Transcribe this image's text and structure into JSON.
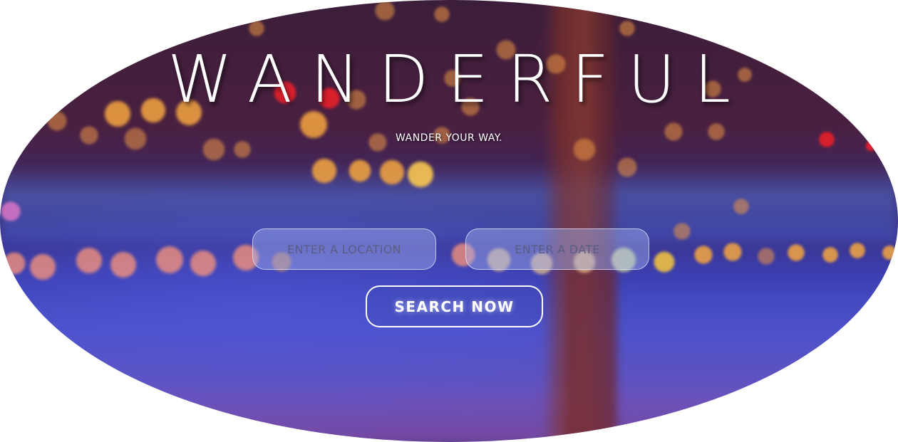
{
  "hero": {
    "title": "WANDERFUL",
    "subtitle": "WANDER YOUR WAY."
  },
  "search": {
    "location_placeholder": "ENTER A LOCATION",
    "date_placeholder": "ENTER A DATE",
    "button_label": "SEARCH NOW"
  },
  "background": {
    "image_subject": "blurred-bridge-bokeh-night",
    "colors": {
      "sky": "#3b1e3a",
      "water": "#4b4fc8",
      "tower": "#8c3c2d",
      "light_warm": "#f5a640",
      "light_red": "#e8202c"
    }
  }
}
